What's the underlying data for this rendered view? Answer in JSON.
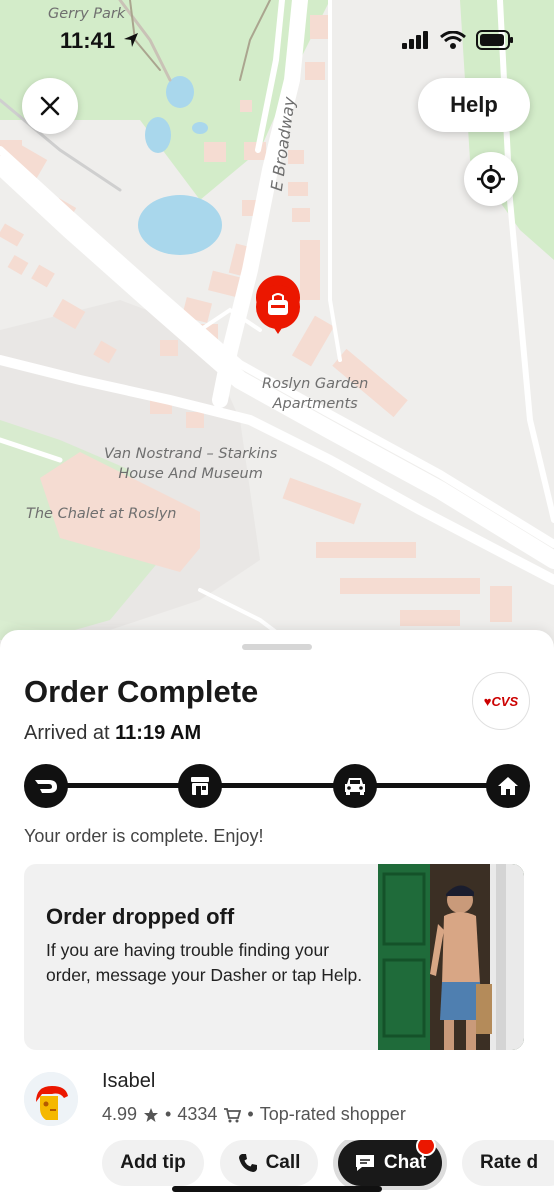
{
  "status_bar": {
    "time": "11:41"
  },
  "map": {
    "labels": {
      "gerry_park": "Gerry Park",
      "street": "E Broadway",
      "roslyn_garden": "Roslyn Garden\nApartments",
      "van_nostrand": "Van Nostrand – Starkins\nHouse And Museum",
      "chalet": "The Chalet at Roslyn"
    },
    "colors": {
      "park": "#d3ecc9",
      "ground": "#efeeec",
      "water": "#a9d7ec",
      "building": "#f5dcd2",
      "road": "#ffffff",
      "pin": "#eb1700"
    }
  },
  "header": {
    "close_icon": "close-icon",
    "help_label": "Help",
    "locate_icon": "locate-icon"
  },
  "order": {
    "title": "Order Complete",
    "arrived_prefix": "Arrived at",
    "arrived_time": "11:19 AM",
    "store_logo_text": "♥CVS",
    "progress_steps": [
      "doordash-icon",
      "store-icon",
      "car-icon",
      "home-icon"
    ],
    "complete_message": "Your order is complete. Enjoy!"
  },
  "dropoff_card": {
    "title": "Order dropped off",
    "body": "If you are having trouble finding your order, message your Dasher or tap Help."
  },
  "dasher": {
    "name": "Isabel",
    "rating": "4.99",
    "rating_icon": "star-icon",
    "deliveries": "4334",
    "deliveries_icon": "cart-icon",
    "badge": "Top-rated shopper"
  },
  "actions": {
    "add_tip": "Add tip",
    "call": "Call",
    "chat": "Chat",
    "rate": "Rate d"
  }
}
